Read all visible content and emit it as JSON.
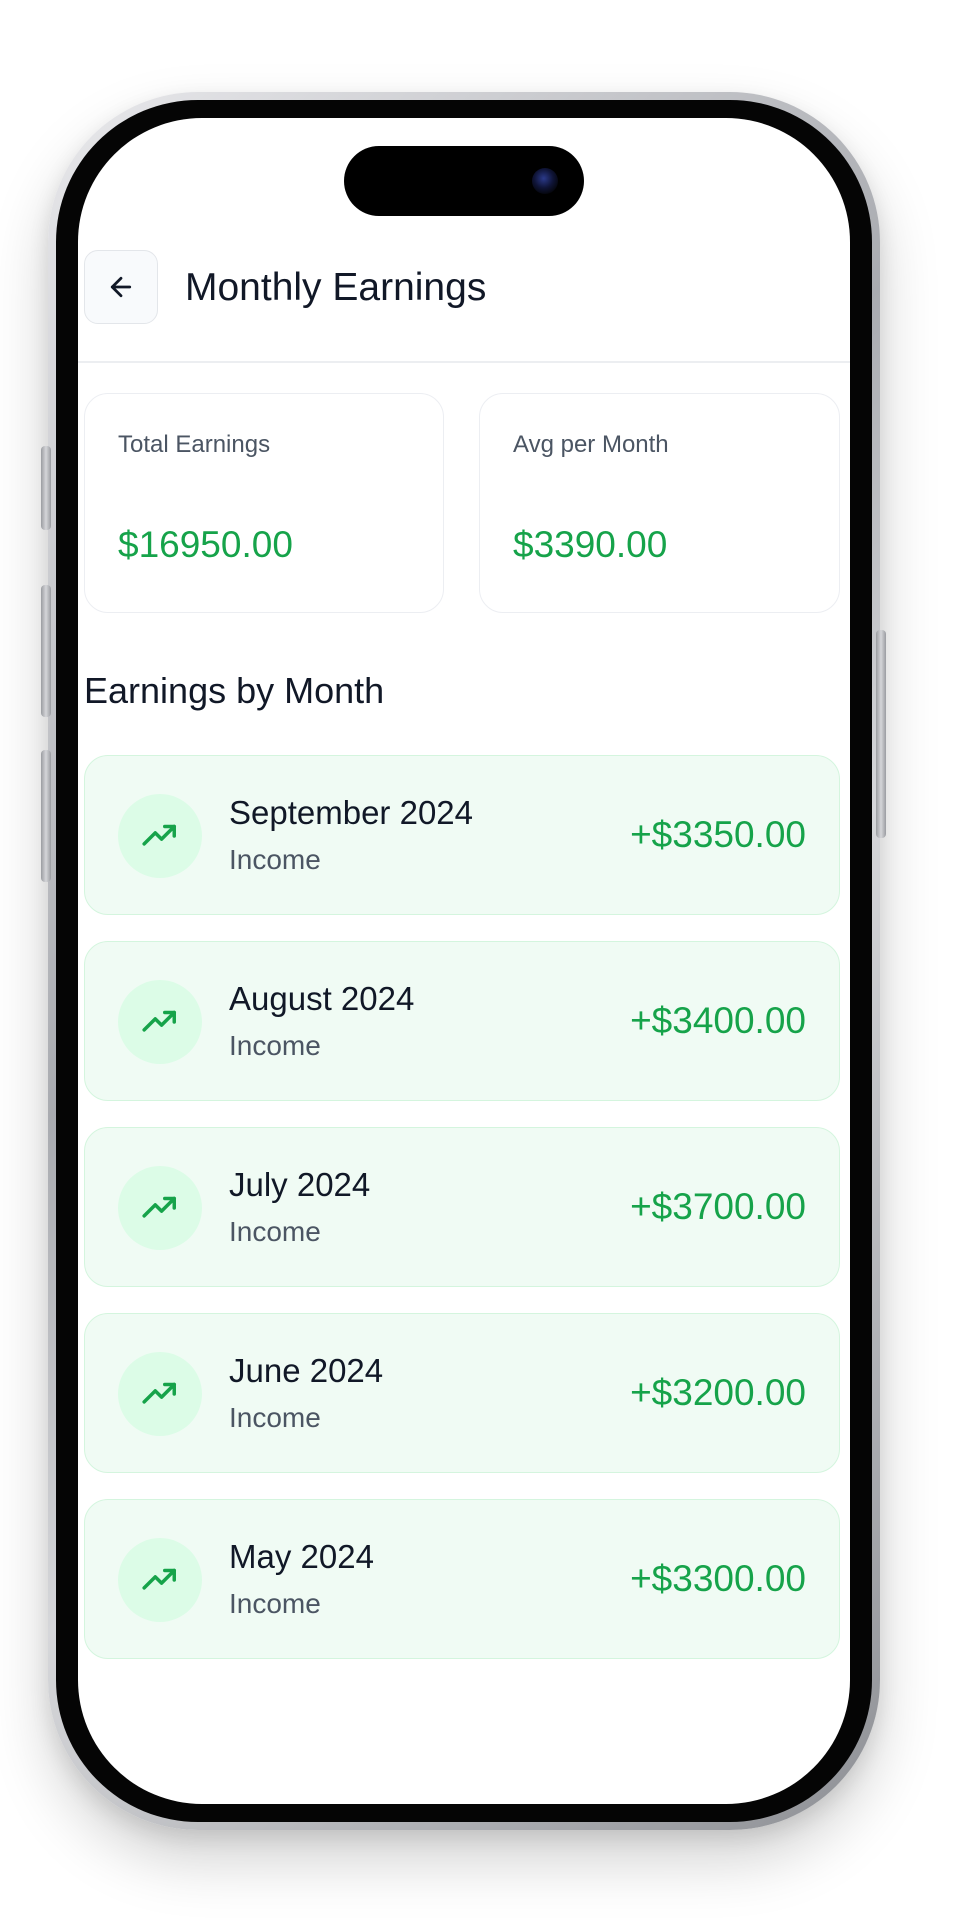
{
  "header": {
    "title": "Monthly Earnings",
    "back_icon": "arrow-left-icon"
  },
  "summary": {
    "total": {
      "label": "Total Earnings",
      "value": "$16950.00"
    },
    "average": {
      "label": "Avg per Month",
      "value": "$3390.00"
    }
  },
  "section_title": "Earnings by Month",
  "months": [
    {
      "name": "September 2024",
      "type": "Income",
      "amount": "+$3350.00",
      "icon": "trending-up-icon"
    },
    {
      "name": "August 2024",
      "type": "Income",
      "amount": "+$3400.00",
      "icon": "trending-up-icon"
    },
    {
      "name": "July 2024",
      "type": "Income",
      "amount": "+$3700.00",
      "icon": "trending-up-icon"
    },
    {
      "name": "June 2024",
      "type": "Income",
      "amount": "+$3200.00",
      "icon": "trending-up-icon"
    },
    {
      "name": "May 2024",
      "type": "Income",
      "amount": "+$3300.00",
      "icon": "trending-up-icon"
    }
  ],
  "colors": {
    "accent_green": "#16a34a",
    "item_background": "#f0fbf4",
    "icon_circle": "#dcfce7",
    "text_primary": "#111827",
    "text_secondary": "#4b5563"
  }
}
